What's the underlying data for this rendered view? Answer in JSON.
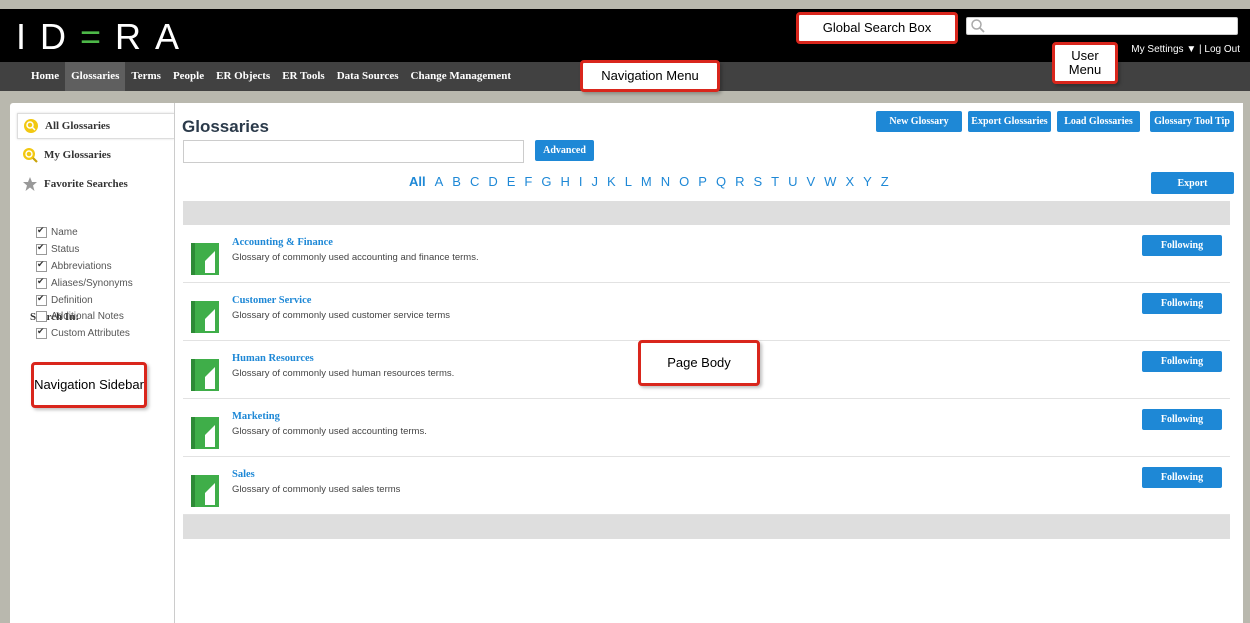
{
  "header": {
    "logo": [
      "I",
      "D",
      "=",
      "R",
      "A"
    ],
    "search_placeholder": "",
    "user_menu": {
      "settings": "My Settings",
      "separator": "|",
      "logout": "Log Out"
    }
  },
  "nav": {
    "items": [
      "Home",
      "Glossaries",
      "Terms",
      "People",
      "ER Objects",
      "ER Tools",
      "Data Sources",
      "Change Management"
    ],
    "active": "Glossaries"
  },
  "sidebar": {
    "items": [
      {
        "label": "All Glossaries",
        "icon": "magnifier-icon"
      },
      {
        "label": "My Glossaries",
        "icon": "magnifier-user-icon"
      },
      {
        "label": "Favorite Searches",
        "icon": "star-icon"
      }
    ],
    "search_in_label": "Search In:",
    "checkboxes": [
      {
        "label": "Name",
        "checked": true
      },
      {
        "label": "Status",
        "checked": true
      },
      {
        "label": "Abbreviations",
        "checked": true
      },
      {
        "label": "Aliases/Synonyms",
        "checked": true
      },
      {
        "label": "Definition",
        "checked": true
      },
      {
        "label": "Additional Notes",
        "checked": false
      },
      {
        "label": "Custom Attributes",
        "checked": true
      }
    ]
  },
  "main": {
    "title": "Glossaries",
    "toolbar": [
      "New Glossary",
      "Export Glossaries",
      "Load Glossaries",
      "Glossary Tool Tip"
    ],
    "advanced_label": "Advanced",
    "export_label": "Export",
    "alphabet": [
      "All",
      "A",
      "B",
      "C",
      "D",
      "E",
      "F",
      "G",
      "H",
      "I",
      "J",
      "K",
      "L",
      "M",
      "N",
      "O",
      "P",
      "Q",
      "R",
      "S",
      "T",
      "U",
      "V",
      "W",
      "X",
      "Y",
      "Z"
    ],
    "glossaries": [
      {
        "title": "Accounting & Finance",
        "description": "Glossary of commonly used accounting and finance terms.",
        "button": "Following"
      },
      {
        "title": "Customer Service",
        "description": "Glossary of commonly used customer service terms",
        "button": "Following"
      },
      {
        "title": "Human Resources",
        "description": "Glossary of commonly used human resources terms.",
        "button": "Following"
      },
      {
        "title": "Marketing",
        "description": "Glossary of commonly used accounting terms.",
        "button": "Following"
      },
      {
        "title": "Sales",
        "description": "Glossary of commonly used sales terms",
        "button": "Following"
      }
    ]
  },
  "callouts": {
    "global_search": "Global Search Box",
    "user_menu": "User Menu",
    "navigation_menu": "Navigation Menu",
    "page_body": "Page Body",
    "navigation_sidebar": "Navigation Sidebar"
  },
  "colors": {
    "accent": "#1e88d6",
    "logo_green": "#4db848",
    "callout_red": "#d9261c",
    "header_bg": "#000000",
    "nav_bg": "#414141",
    "glossary_icon": "#3fae49"
  }
}
